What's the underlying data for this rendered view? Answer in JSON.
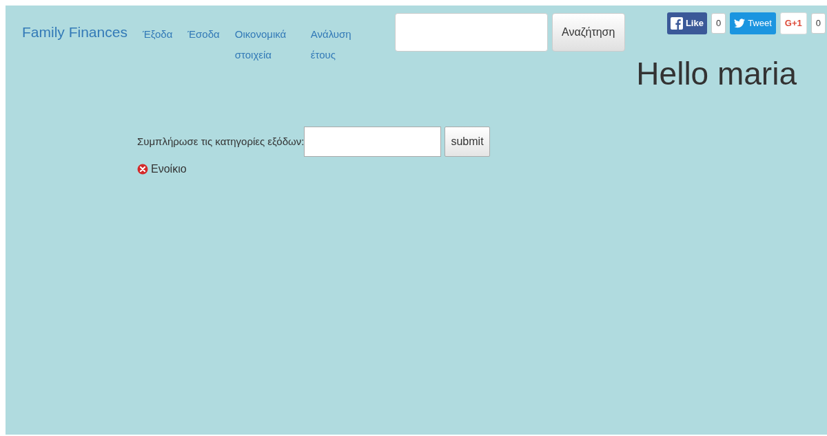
{
  "brand": "Family Finances",
  "nav": [
    {
      "label": "Έξοδα"
    },
    {
      "label": "Έσοδα"
    },
    {
      "label": "Οικονομικά στοιχεία"
    },
    {
      "label": "Ανάλυση έτους"
    }
  ],
  "search": {
    "button": "Αναζήτηση"
  },
  "social": [
    {
      "kind": "facebook",
      "label": "Like",
      "count": "0"
    },
    {
      "kind": "twitter",
      "label": "Tweet"
    },
    {
      "kind": "gplus",
      "label": "G+1",
      "count": "0"
    }
  ],
  "greeting": "Hello maria",
  "form": {
    "label": "Συμπλήρωσε τις κατηγορίες εξόδων:",
    "button": "submit"
  },
  "categories": [
    {
      "label": "Ενοίκιο"
    }
  ]
}
